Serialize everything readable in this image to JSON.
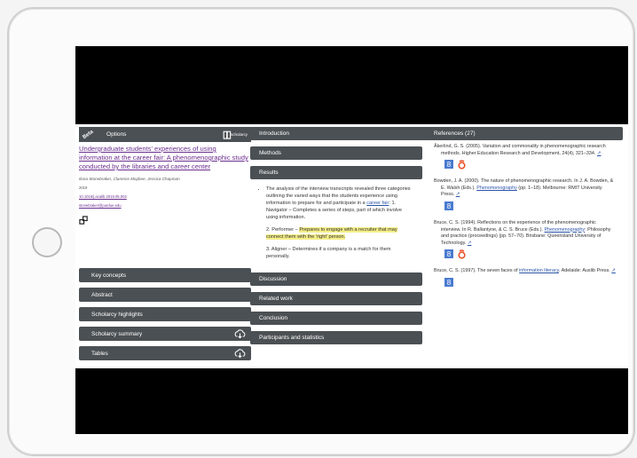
{
  "left_panel": {
    "beta": "Beta",
    "options": "Options",
    "logo_text": "scholarcy",
    "title": "Undergraduate students' experiences of using information at the career fair: A phenomenographic study conducted by the libraries and career center",
    "authors": "Ilona Stonebraker, Clarence Maybee, Jessica Chapman",
    "year": "2019",
    "doi": "10.1016/j.acalib.2019.05.002",
    "email": "stonebraker@purdue.edu",
    "menu": [
      {
        "label": "Key concepts"
      },
      {
        "label": "Abstract"
      },
      {
        "label": "Scholarcy highlights"
      },
      {
        "label": "Scholarcy summary"
      },
      {
        "label": "Tables"
      }
    ]
  },
  "middle_panel": {
    "top_sections": [
      "Introduction",
      "Methods",
      "Results"
    ],
    "results": {
      "p1_pre": "The analysis of the interview transcripts revealed three categories outlining the varied ways that the students experience using information to prepare for and participate in a ",
      "p1_link": "career fair",
      "p1_post": ": 1. Navigator – Completes a series of steps, part of which involve using information.",
      "p2_pre": "2. Performer – ",
      "p2_highlight": "Prepares to engage with a recruiter that may connect them with the 'right' person.",
      "p3": "3. Aligner – Determines if a company is a match for them personally."
    },
    "bottom_sections": [
      "Discussion",
      "Related work",
      "Conclusion",
      "Participants and statistics"
    ]
  },
  "references": {
    "title": "References (27)",
    "items": [
      {
        "pre": "Åkerlind, G. S. (2005). Variation and commonality in phenomenographic research methods. Higher Education Research and Development, 24(4), 321–334. ",
        "link": "",
        "post": "",
        "arrow": "↗",
        "icons": [
          "google-scholar",
          "mendeley"
        ]
      },
      {
        "pre": "Bowden, J. A. (2000). The nature of phenomenographic research. In J. A. Bowden, & E. Walsh (Eds.). ",
        "link": "Phenomenography",
        "post": " (pp. 1–18). Melbourne: RMIT University Press. ",
        "arrow": "↗",
        "icons": [
          "google-scholar"
        ]
      },
      {
        "pre": "Bruce, C. S. (1994). Reflections on the experience of the phenomenographic interview. In R. Ballantyne, & C. S. Bruce (Eds.). ",
        "link": "Phenomenography",
        "post": ": Philosophy and practice (proceedings) (pp. 57–70). Brisbane: Queensland University of Technology. ",
        "arrow": "↗",
        "icons": [
          "google-scholar",
          "mendeley"
        ]
      },
      {
        "pre": "Bruce, C. S. (1997). The seven faces of ",
        "link": "information literacy",
        "post": ". Adelaide: Auslib Press. ",
        "arrow": "↗",
        "icons": [
          "google-scholar"
        ]
      }
    ]
  },
  "colors": {
    "bar": "#4b5054",
    "link": "#6b2e8e",
    "highlight": "#f4ee88",
    "mendeley": "#e8532b",
    "scholar": "#4a7bd0"
  }
}
